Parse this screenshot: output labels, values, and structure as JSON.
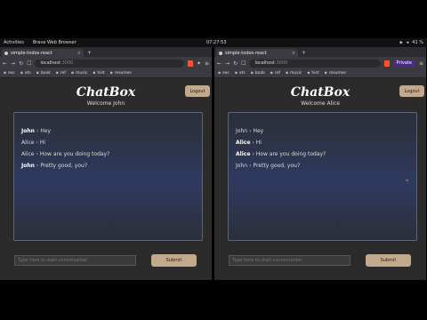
{
  "system": {
    "activities": "Activities",
    "app_menu": "Brave Web Browser",
    "clock": "07:27:53",
    "battery": "41 %"
  },
  "windows": [
    {
      "tab_title": "simple-todos-react",
      "url_host": "localhost",
      "url_port": ":3000",
      "bookmarks": [
        "exc",
        "ets",
        "book",
        "ref",
        "music",
        "hist",
        "resumes"
      ],
      "private_label": "",
      "app_title": "ChatBox",
      "welcome": "Welcome John",
      "logout_label": "Logout",
      "messages": [
        {
          "author": "John",
          "text": "Hey",
          "bold": true
        },
        {
          "author": "Alice",
          "text": "Hi",
          "bold": false
        },
        {
          "author": "Alice",
          "text": "How are you doing today?",
          "bold": false
        },
        {
          "author": "John",
          "text": "Pretty good, you?",
          "bold": true
        }
      ],
      "input_placeholder": "Type here to start conversation",
      "submit_label": "Submit"
    },
    {
      "tab_title": "simple-todos-react",
      "url_host": "localhost",
      "url_port": ":3000",
      "bookmarks": [
        "exc",
        "ets",
        "book",
        "ref",
        "music",
        "hist",
        "resumes"
      ],
      "private_label": "Private",
      "app_title": "ChatBox",
      "welcome": "Welcome Alice",
      "logout_label": "Logout",
      "messages": [
        {
          "author": "John",
          "text": "Hey",
          "bold": false
        },
        {
          "author": "Alice",
          "text": "Hi",
          "bold": true
        },
        {
          "author": "Alice",
          "text": "How are you doing today?",
          "bold": true
        },
        {
          "author": "John",
          "text": "Pretty good, you?",
          "bold": false
        }
      ],
      "input_placeholder": "Type here to start conversation",
      "submit_label": "Submit"
    }
  ]
}
